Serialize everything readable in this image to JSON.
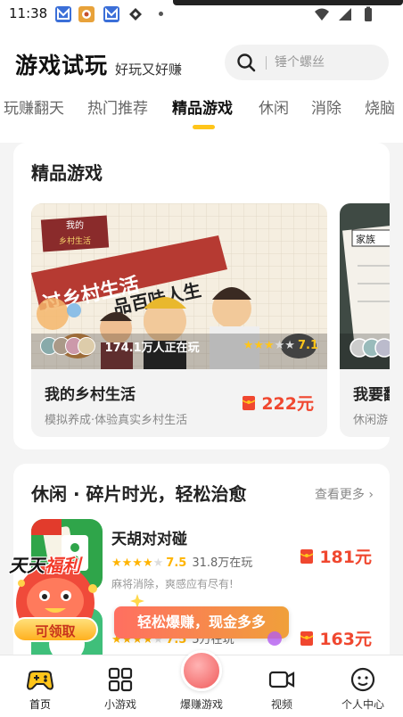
{
  "status_bar": {
    "time": "11:38"
  },
  "header": {
    "title": "游戏试玩",
    "subtitle": "好玩又好赚",
    "search_placeholder": "锤个螺丝"
  },
  "tabs": [
    {
      "label": "玩赚翻天",
      "active": false
    },
    {
      "label": "热门推荐",
      "active": false
    },
    {
      "label": "精品游戏",
      "active": true
    },
    {
      "label": "休闲",
      "active": false
    },
    {
      "label": "消除",
      "active": false
    },
    {
      "label": "烧脑",
      "active": false
    }
  ],
  "featured": {
    "section_title": "精品游戏",
    "games": [
      {
        "name": "我的乡村生活",
        "desc": "模拟养成·体验真实乡村生活",
        "players": "174.1万人正在玩",
        "rating": "7.1",
        "reward": "222元",
        "art_caption_1": "过乡村生活",
        "art_caption_2": "品百味人生",
        "art_stamp": "我的",
        "art_stamp_2": "乡村生活"
      },
      {
        "name": "我要翻",
        "desc": "休闲游",
        "art_caption_1": "家族"
      }
    ]
  },
  "casual": {
    "section_title": "休闲 · 碎片时光，轻松治愈",
    "more_label": "查看更多",
    "games": [
      {
        "name": "天胡对对碰",
        "rating": "7.5",
        "players": "31.8万在玩",
        "desc": "麻将消除，爽感应有尽有!",
        "reward": "181元",
        "stars_full": 3,
        "stars_half": 1
      },
      {
        "rating": "7.5",
        "players": "5万在玩",
        "reward": "163元",
        "stars_full": 3,
        "stars_half": 1
      }
    ]
  },
  "float_widget": {
    "title_a": "天天",
    "title_b": "福利",
    "button": "可领取"
  },
  "toast": {
    "text": "轻松爆赚，现金多多"
  },
  "bottom_nav": [
    {
      "label": "首页",
      "icon": "gamepad-icon"
    },
    {
      "label": "小游戏",
      "icon": "grid-icon"
    },
    {
      "label": "爆赚游戏",
      "icon": "money-icon"
    },
    {
      "label": "视频",
      "icon": "video-icon"
    },
    {
      "label": "个人中心",
      "icon": "smile-icon"
    }
  ],
  "colors": {
    "accent_yellow": "#ffc51a",
    "reward_red": "#f0472f"
  }
}
